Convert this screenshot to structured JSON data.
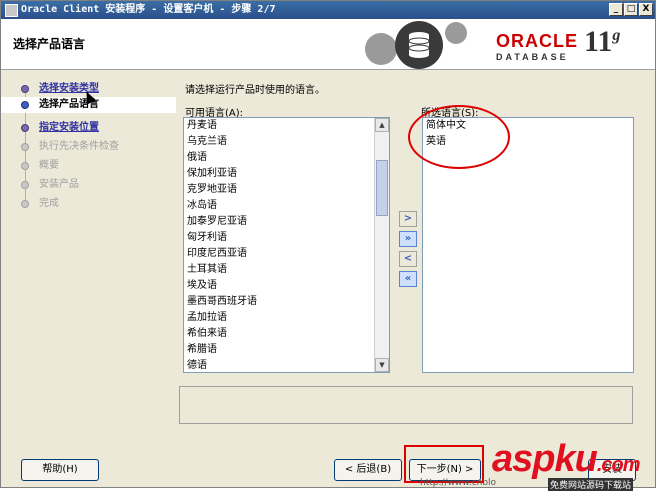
{
  "window": {
    "title": "Oracle Client 安装程序 - 设置客户机 - 步骤 2/7",
    "minimize_glyph": "_",
    "maximize_glyph": "□",
    "close_glyph": "X"
  },
  "header": {
    "title": "选择产品语言",
    "oracle_word": "ORACLE",
    "database_word": "DATABASE",
    "version": "11",
    "version_suffix": "g"
  },
  "steps": [
    {
      "label": "选择安装类型",
      "state": "link"
    },
    {
      "label": "选择产品语言",
      "state": "current"
    },
    {
      "label": "指定安装位置",
      "state": "link"
    },
    {
      "label": "执行先决条件检查",
      "state": "disabled"
    },
    {
      "label": "概要",
      "state": "disabled"
    },
    {
      "label": "安装产品",
      "state": "disabled"
    },
    {
      "label": "完成",
      "state": "disabled"
    }
  ],
  "main": {
    "instruction": "请选择运行产品时使用的语言。",
    "available_label": "可用语言(A):",
    "selected_label": "所选语言(S):",
    "available_languages": [
      "丹麦语",
      "乌克兰语",
      "俄语",
      "保加利亚语",
      "克罗地亚语",
      "冰岛语",
      "加泰罗尼亚语",
      "匈牙利语",
      "印度尼西亚语",
      "土耳其语",
      "埃及语",
      "墨西哥西班牙语",
      "孟加拉语",
      "希伯来语",
      "希腊语",
      "德语"
    ],
    "selected_languages": [
      "简体中文",
      "英语"
    ],
    "move_buttons": [
      ">",
      "»",
      "<",
      "«"
    ]
  },
  "footer": {
    "help": "帮助(H)",
    "back": "< 后退(B)",
    "next": "下一步(N) >",
    "install": "安装"
  },
  "watermark": {
    "brand": "aspku",
    "suffix": ".com",
    "url": "http://www.cnblo",
    "tag": "免费网站源码下载站"
  }
}
